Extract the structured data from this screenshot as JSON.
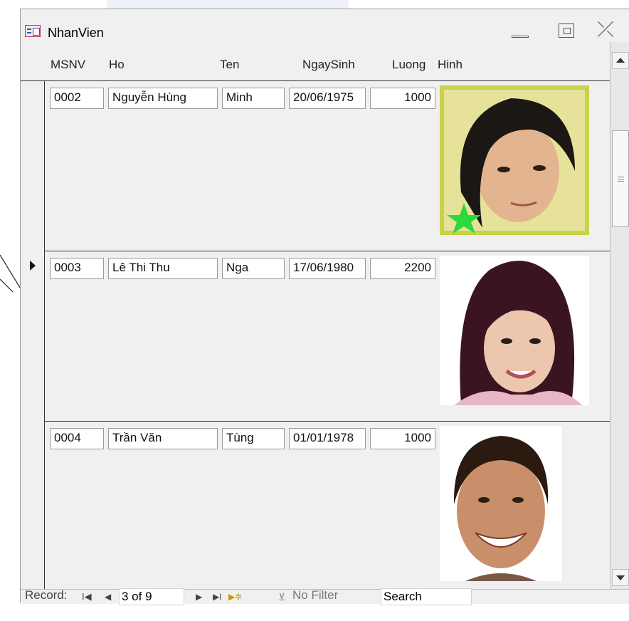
{
  "window": {
    "title": "NhanVien"
  },
  "columns": [
    "MSNV",
    "Ho",
    "Ten",
    "NgaySinh",
    "Luong",
    "Hinh"
  ],
  "records": [
    {
      "msnv": "0002",
      "ho": "Nguyễn Hùng",
      "ten": "Minh",
      "ngaysinh": "20/06/1975",
      "luong": "1000",
      "photo": "man-photo"
    },
    {
      "msnv": "0003",
      "ho": "Lê Thi Thu",
      "ten": "Nga",
      "ngaysinh": "17/06/1980",
      "luong": "2200",
      "photo": "woman-photo",
      "current": true
    },
    {
      "msnv": "0004",
      "ho": "Trần Văn",
      "ten": "Tùng",
      "ngaysinh": "01/01/1978",
      "luong": "1000",
      "photo": "man-photo-smiling"
    }
  ],
  "navigation": {
    "label": "Record:",
    "first": "I◀",
    "prev": "◀",
    "current": "3 of 9",
    "next": "▶",
    "last": "▶I",
    "new": "▶✲",
    "filter": "No Filter",
    "search": "Search"
  }
}
